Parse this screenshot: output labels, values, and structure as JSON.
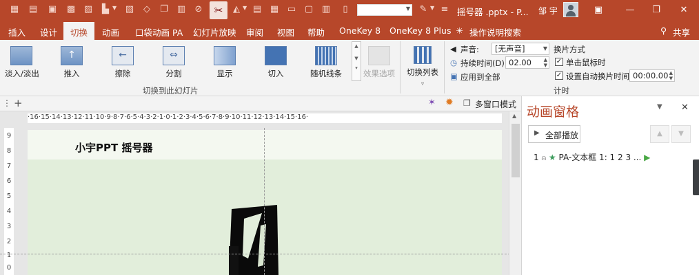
{
  "titlebar": {
    "name_box_value": "",
    "doc_title": "摇号器 .pptx - P...",
    "user_name": "邹 宇"
  },
  "tabs": [
    "插入",
    "设计",
    "切换",
    "动画",
    "口袋动画 PA",
    "幻灯片放映",
    "审阅",
    "视图",
    "帮助",
    "OneKey 8",
    "OneKey 8 Plus",
    "操作说明搜索"
  ],
  "active_tab": "切换",
  "share_label": "共享",
  "ribbon": {
    "effects": [
      "淡入/淡出",
      "推入",
      "擦除",
      "分割",
      "显示",
      "切入",
      "随机线条"
    ],
    "effect_options": "效果选项",
    "group_label": "切换到此幻灯片",
    "switch_list": "切换列表",
    "sound_label": "声音:",
    "sound_value": "[无声音]",
    "duration_label": "持续时间(D):",
    "duration_value": "02.00",
    "apply_all": "应用到全部",
    "advance_title": "换片方式",
    "on_click": "单击鼠标时",
    "after_time": "设置自动换片时间:",
    "after_value": "00:00.00",
    "timing_group": "计时"
  },
  "toolbar2": {
    "multi_window": "多窗口模式"
  },
  "ruler": {
    "h": "·16·15·14·13·12·11·10·9·8·7·6·5·4·3·2·1·0·1·2·3·4·5·6·7·8·9·10·11·12·13·14·15·16·",
    "v": [
      "9",
      "8",
      "7",
      "6",
      "5",
      "4",
      "3",
      "2",
      "1",
      "0"
    ]
  },
  "slide": {
    "title": "小宇PPT    摇号器"
  },
  "pane": {
    "title": "动画窗格",
    "play_all": "全部播放",
    "item_number": "1",
    "item_label": "PA-文本框 1: 1 2 3 ..."
  },
  "colors": {
    "accent": "#b7472a",
    "slide_bg": "#e2eedb"
  }
}
